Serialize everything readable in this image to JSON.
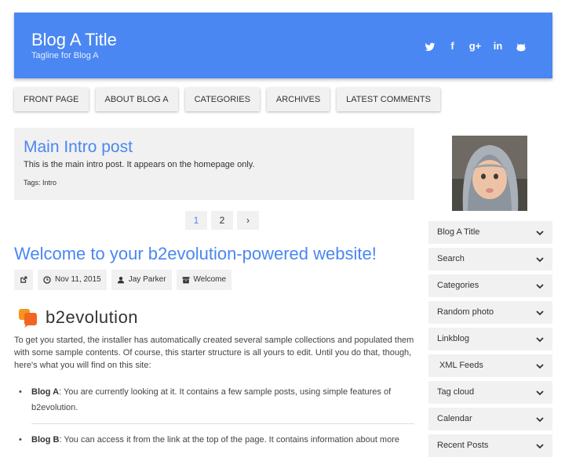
{
  "header": {
    "title": "Blog A Title",
    "tagline": "Tagline for Blog A",
    "social": [
      "twitter-icon",
      "facebook-icon",
      "google-plus-icon",
      "linkedin-icon",
      "github-icon"
    ],
    "social_glyphs": {
      "fb": "f",
      "gplus": "g+",
      "in": "in"
    }
  },
  "nav": [
    "FRONT PAGE",
    "ABOUT BLOG A",
    "CATEGORIES",
    "ARCHIVES",
    "LATEST COMMENTS"
  ],
  "intro": {
    "title": "Main Intro post",
    "text": "This is the main intro post. It appears on the homepage only.",
    "tags_label": "Tags:",
    "tag": "Intro"
  },
  "pager": {
    "pages": [
      "1",
      "2"
    ],
    "next": "›",
    "active": "1"
  },
  "post": {
    "title": "Welcome to your b2evolution-powered website!",
    "date": "Nov 11, 2015",
    "author": "Jay Parker",
    "category": "Welcome",
    "logo_text": "b2evolution",
    "body": "To get you started, the installer has automatically created several sample collections and populated them with some sample contents. Of course, this starter structure is all yours to edit. Until you do that, though, here's what you will find on this site:",
    "items": [
      {
        "name": "Blog A",
        "text": ": You are currently looking at it. It contains a few sample posts, using simple features of b2evolution."
      },
      {
        "name": "Blog B",
        "text": ": You can access it from the link at the top of the page. It contains information about more"
      }
    ]
  },
  "sidebar": {
    "widgets": [
      "Blog A Title",
      "Search",
      "Categories",
      "Random photo",
      "Linkblog",
      " XML Feeds",
      "Tag cloud",
      "Calendar",
      "Recent Posts"
    ]
  },
  "colors": {
    "accent": "#4a87f2",
    "panel": "#f1f1f1"
  }
}
